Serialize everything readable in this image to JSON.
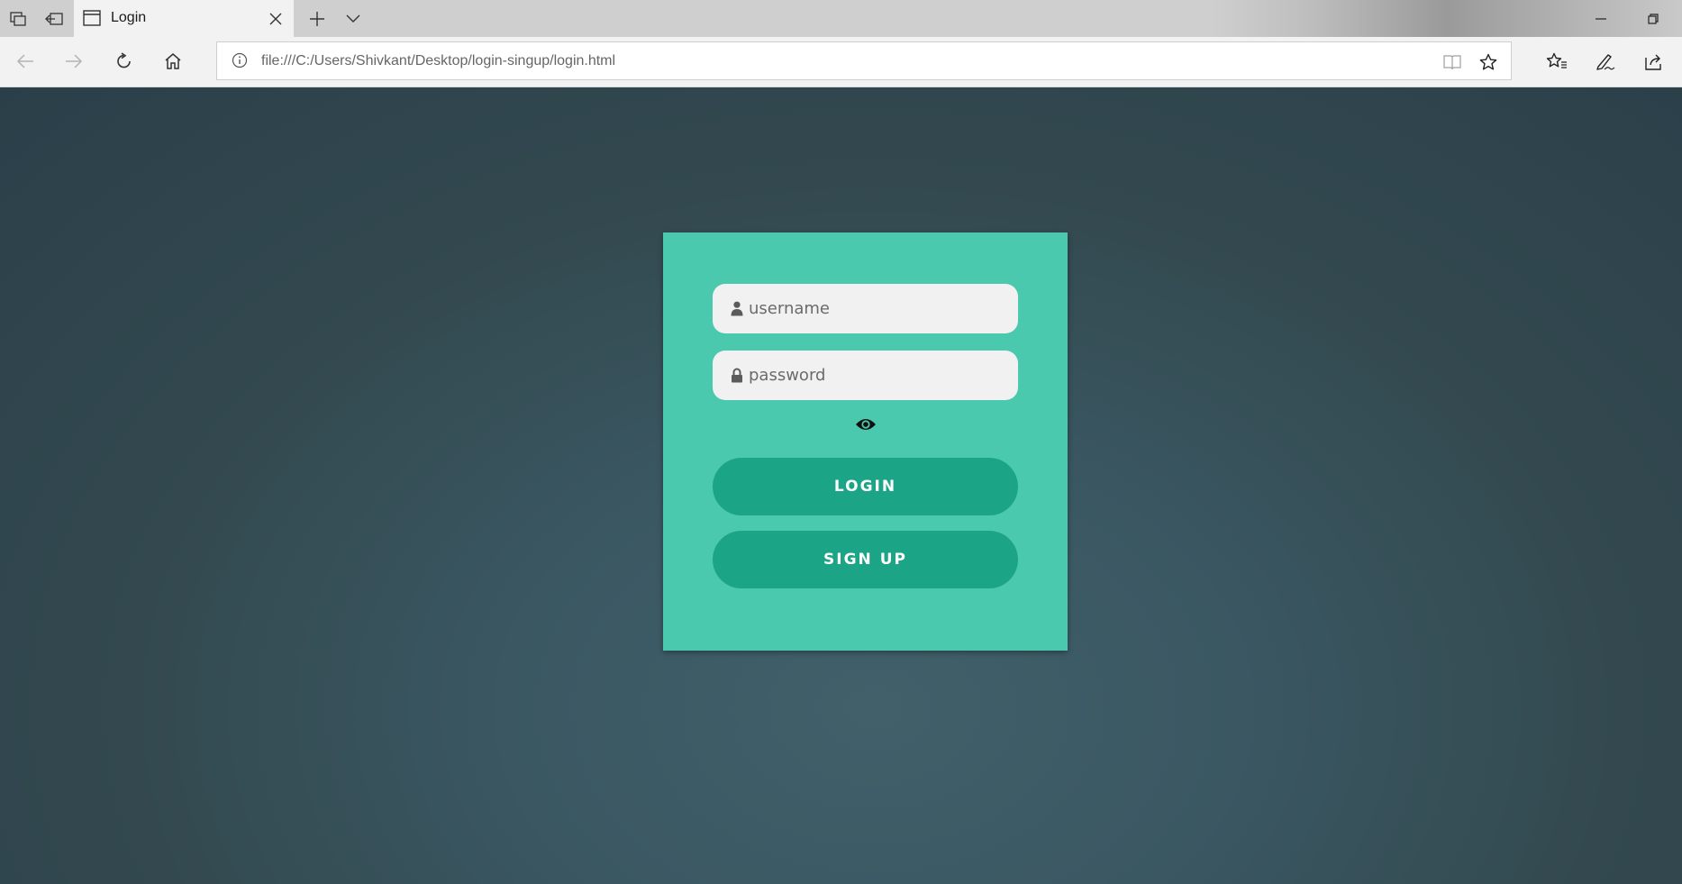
{
  "browser": {
    "tab": {
      "title": "Login"
    },
    "address_bar": {
      "url": "file:///C:/Users/Shivkant/Desktop/login-singup/login.html"
    },
    "icons": {
      "tab_actions": [
        "tabs-aside-icon",
        "restore-tabs-icon"
      ],
      "tab_page": "page-icon",
      "new_tab": "plus-icon",
      "tab_list": "chevron-down-icon",
      "nav": [
        "back-arrow-icon",
        "forward-arrow-icon",
        "refresh-icon",
        "home-icon"
      ],
      "address": [
        "info-icon",
        "reading-view-icon",
        "star-icon"
      ],
      "toolbar": [
        "favorites-icon",
        "pen-icon",
        "share-icon"
      ],
      "window": [
        "minimize-icon",
        "restore-icon"
      ]
    }
  },
  "login_form": {
    "username": {
      "placeholder": "username",
      "value": "",
      "icon": "user-icon"
    },
    "password": {
      "placeholder": "password",
      "value": "",
      "icon": "lock-icon"
    },
    "show_password_icon": "eye-icon",
    "login_label": "LOGIN",
    "signup_label": "SIGN UP"
  },
  "colors": {
    "background": "#36505b",
    "card": "#4bc9ae",
    "button": "#1ba586",
    "input": "#f1f1f1",
    "button_text": "#ffffff"
  }
}
